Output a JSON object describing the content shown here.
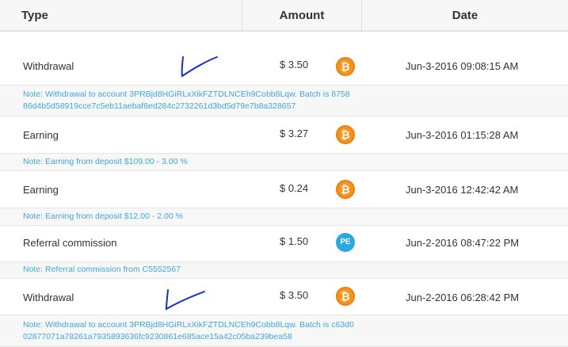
{
  "header": {
    "type": "Type",
    "amount": "Amount",
    "date": "Date"
  },
  "rows": [
    {
      "type": "Withdrawal",
      "amount": "$ 3.50",
      "coin": "bitcoin-icon",
      "date": "Jun-3-2016 09:08:15 AM",
      "note": "Note: Withdrawal to account 3PRBjd8HGiRLxXikFZTDLNCEh9Cobb8Lqw. Batch is 875886d4b5d58919cce7c5eb11aebaf8ed284c2732261d3bd5d79e7b8a328657"
    },
    {
      "type": "Earning",
      "amount": "$ 3.27",
      "coin": "bitcoin-icon",
      "date": "Jun-3-2016 01:15:28 AM",
      "note": "Note: Earning from deposit $109.00 - 3.00 %"
    },
    {
      "type": "Earning",
      "amount": "$ 0.24",
      "coin": "bitcoin-icon",
      "date": "Jun-3-2016 12:42:42 AM",
      "note": "Note: Earning from deposit $12.00 - 2.00 %"
    },
    {
      "type": "Referral commission",
      "amount": "$ 1.50",
      "coin": "payeer-icon",
      "coin_label": "PE",
      "date": "Jun-2-2016 08:47:22 PM",
      "note": "Note: Referral commission from C5552567"
    },
    {
      "type": "Withdrawal",
      "amount": "$ 3.50",
      "coin": "bitcoin-icon",
      "date": "Jun-2-2016 06:28:42 PM",
      "note": "Note: Withdrawal to account 3PRBjd8HGiRLxXikFZTDLNCEh9Cobb8Lqw. Batch is c63d002877071a78261a7935893636fc9230861e685ace15a42c05ba239bea58"
    }
  ],
  "bitcoin_symbol": "₿",
  "colors": {
    "bitcoin": "#f7931a",
    "payeer": "#2aa9e0",
    "note_text": "#3fa8d8",
    "check_mark": "#1a2fc9"
  }
}
